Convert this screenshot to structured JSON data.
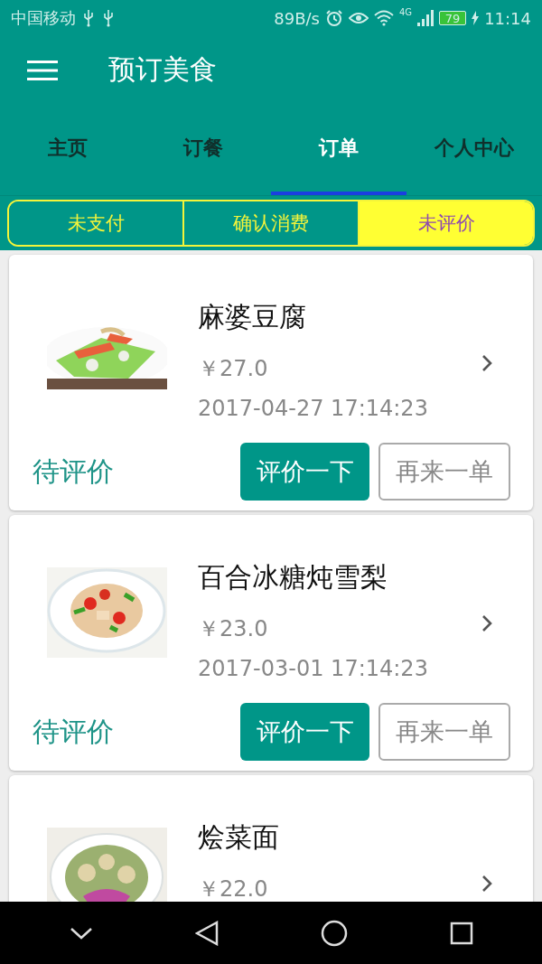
{
  "status_bar": {
    "carrier": "中国移动",
    "speed": "89B/s",
    "network": "4G",
    "battery": "79",
    "time": "11:14"
  },
  "app_bar": {
    "title": "预订美食"
  },
  "tabs": [
    {
      "label": "主页",
      "selected": false
    },
    {
      "label": "订餐",
      "selected": false
    },
    {
      "label": "订单",
      "selected": true
    },
    {
      "label": "个人中心",
      "selected": false
    }
  ],
  "filters": [
    {
      "label": "未支付",
      "selected": false
    },
    {
      "label": "确认消费",
      "selected": false
    },
    {
      "label": "未评价",
      "selected": true
    }
  ],
  "orders": [
    {
      "name": "麻婆豆腐",
      "price": "￥27.0",
      "time": "2017-04-27 17:14:23",
      "status": "待评价",
      "actions": [
        "评价一下",
        "再来一单"
      ]
    },
    {
      "name": "百合冰糖炖雪梨",
      "price": "￥23.0",
      "time": "2017-03-01 17:14:23",
      "status": "待评价",
      "actions": [
        "评价一下",
        "再来一单"
      ]
    },
    {
      "name": "烩菜面",
      "price": "￥22.0"
    }
  ]
}
